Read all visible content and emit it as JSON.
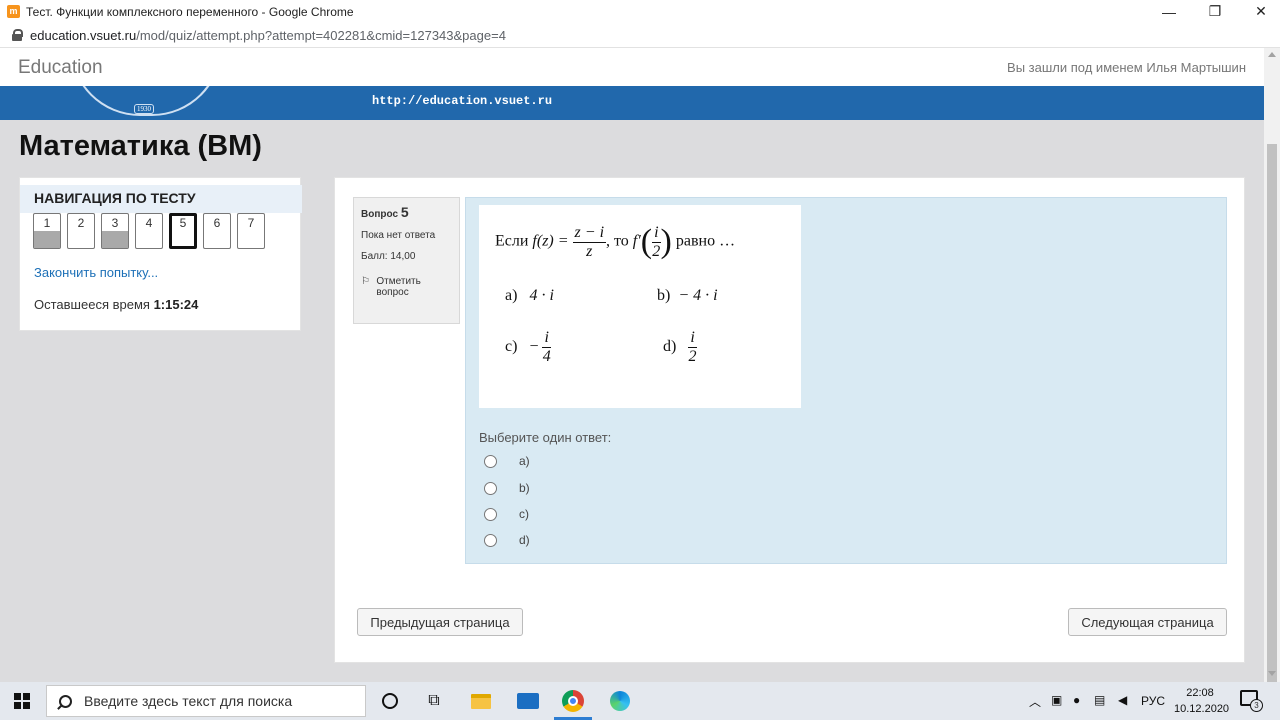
{
  "window": {
    "title": "Тест. Функции комплексного переменного - Google Chrome",
    "minimize_glyph": "—",
    "maximize_glyph": "❐",
    "close_glyph": "✕"
  },
  "address": {
    "host": "education.vsuet.ru",
    "path": "/mod/quiz/attempt.php?attempt=402281&cmid=127343&page=4"
  },
  "site": {
    "brand": "Education",
    "user_text": "Вы зашли под именем Илья Мартышин",
    "logo_year": "1930",
    "banner_url": "http://education.vsuet.ru"
  },
  "page_title": "Математика (ВМ)",
  "quiz_nav": {
    "heading": "НАВИГАЦИЯ ПО ТЕСТУ",
    "questions": [
      {
        "label": "1",
        "answered": true,
        "current": false
      },
      {
        "label": "2",
        "answered": false,
        "current": false
      },
      {
        "label": "3",
        "answered": true,
        "current": false
      },
      {
        "label": "4",
        "answered": false,
        "current": false
      },
      {
        "label": "5",
        "answered": false,
        "current": true
      },
      {
        "label": "6",
        "answered": false,
        "current": false
      },
      {
        "label": "7",
        "answered": false,
        "current": false
      }
    ],
    "finish_link": "Закончить попытку...",
    "time_label": "Оставшееся время",
    "time_value": "1:15:24"
  },
  "question": {
    "label": "Вопрос",
    "number": "5",
    "status": "Пока нет ответа",
    "score": "Балл: 14,00",
    "flag_label": "Отметить вопрос",
    "prompt": "Выберите один ответ:",
    "options": [
      "a)",
      "b)",
      "c)",
      "d)"
    ],
    "formula": {
      "if_word": "Если",
      "f_of_z": "f(z) =",
      "numerator": "z − i",
      "denominator": "z",
      "then_word": ", то",
      "f_prime": "f′",
      "arg_num": "i",
      "arg_den": "2",
      "equals_word": "равно …",
      "answers": [
        {
          "letter": "a)",
          "text": "4 · i"
        },
        {
          "letter": "b)",
          "text": "− 4 · i"
        },
        {
          "letter": "c)",
          "sign": "−",
          "num": "i",
          "den": "4"
        },
        {
          "letter": "d)",
          "num": "i",
          "den": "2"
        }
      ]
    }
  },
  "nav_buttons": {
    "prev": "Предыдущая страница",
    "next": "Следующая страница"
  },
  "taskbar": {
    "search_placeholder": "Введите здесь текст для поиска",
    "language": "РУС",
    "time": "22:08",
    "date": "10.12.2020",
    "notification_count": "3"
  }
}
